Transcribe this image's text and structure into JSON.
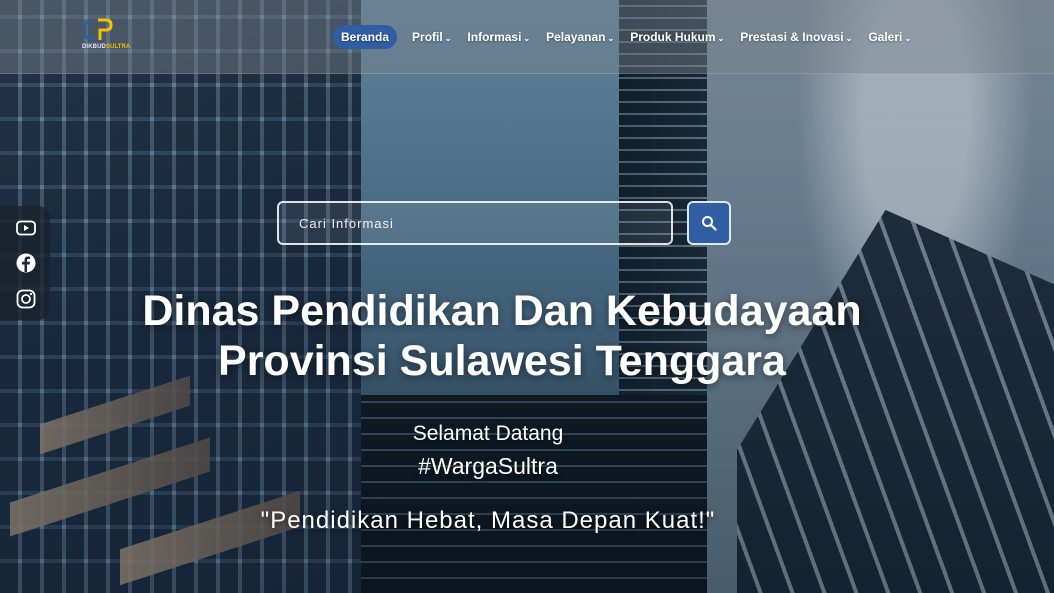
{
  "brand": {
    "logo_text_main": "DIKBUD",
    "logo_text_accent": "SULTRA"
  },
  "nav": {
    "items": [
      {
        "label": "Beranda",
        "active": true
      },
      {
        "label": "Profil",
        "chevron": "⌄"
      },
      {
        "label": "Informasi",
        "chevron": "⌄"
      },
      {
        "label": "Pelayanan",
        "chevron": "⌄"
      },
      {
        "label": "Produk Hukum",
        "chevron": "⌄"
      },
      {
        "label": "Prestasi & Inovasi",
        "chevron": "⌄"
      },
      {
        "label": "Galeri",
        "chevron": "⌄"
      }
    ]
  },
  "search": {
    "placeholder": "Cari Informasi",
    "button_icon": "search-icon"
  },
  "social": {
    "items": [
      "youtube-icon",
      "facebook-icon",
      "instagram-icon"
    ]
  },
  "hero": {
    "title_line1": "Dinas Pendidikan Dan Kebudayaan",
    "title_line2": "Provinsi Sulawesi Tenggara",
    "welcome": "Selamat Datang",
    "hashtag": "#WargaSultra",
    "tagline": "\"Pendidikan Hebat, Masa Depan Kuat!\""
  },
  "colors": {
    "accent": "#2f5ea3",
    "logo_yellow": "#f2c200",
    "text": "#ffffff"
  }
}
